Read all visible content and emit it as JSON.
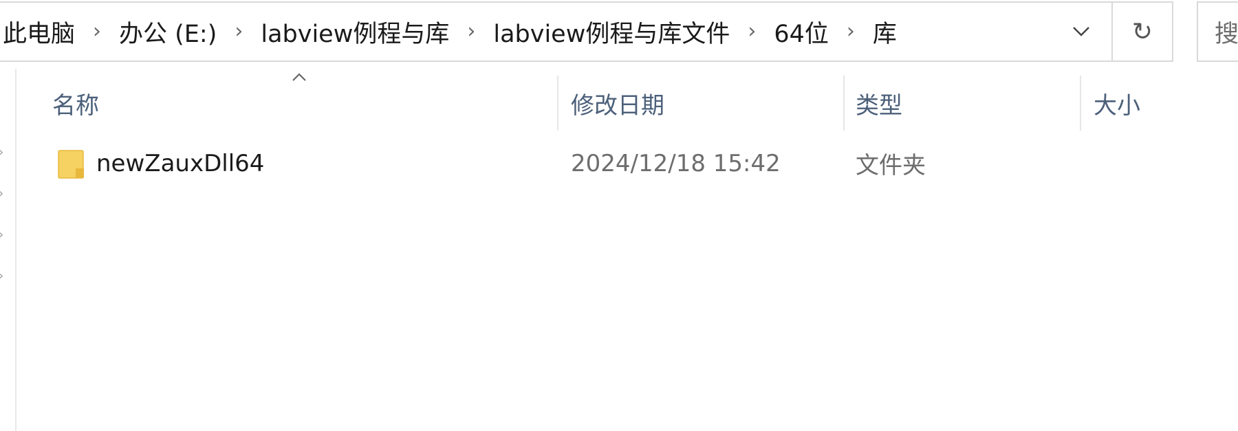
{
  "address": {
    "crumbs": [
      "此电脑",
      "办公 (E:)",
      "labview例程与库",
      "labview例程与库文件",
      "64位",
      "库"
    ],
    "separator": "›",
    "dropdown_icon": "chevron-down-icon",
    "refresh_icon": "refresh-icon",
    "refresh_glyph": "↻"
  },
  "search": {
    "placeholder": "搜"
  },
  "columns": {
    "name": "名称",
    "date": "修改日期",
    "type": "类型",
    "size": "大小"
  },
  "sort": {
    "column": "name",
    "icon": "sort-up-icon"
  },
  "files": [
    {
      "name": "newZauxDll64",
      "date": "2024/12/18 15:42",
      "type": "文件夹",
      "size": "",
      "icon": "folder-icon"
    }
  ],
  "colors": {
    "header_text": "#4c607a",
    "folder": "#f6d262",
    "folder_dark": "#e7b83c"
  }
}
